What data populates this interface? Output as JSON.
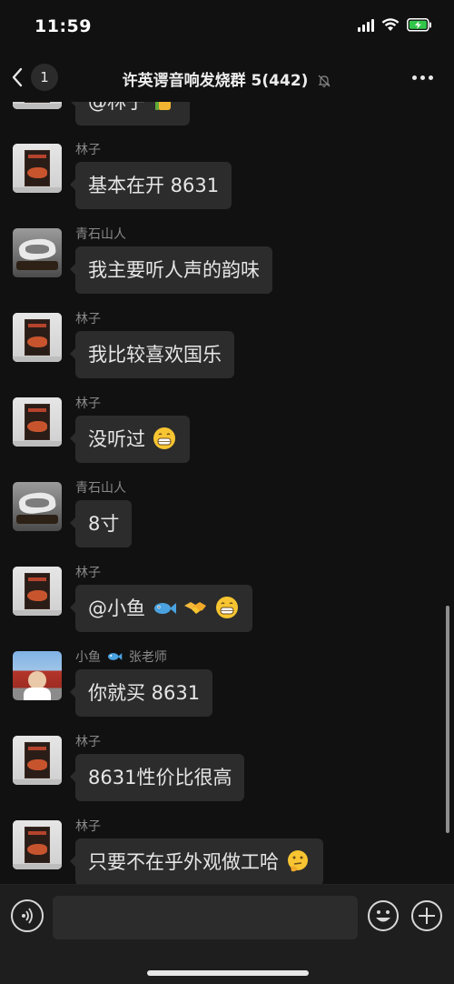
{
  "status_bar": {
    "time": "11:59"
  },
  "header": {
    "back_count": "1",
    "title": "许英谔音响发烧群 5(442)"
  },
  "messages": [
    {
      "sender": "",
      "text": "@林子",
      "avatar": "lin"
    },
    {
      "sender": "林子",
      "text": "基本在开 8631",
      "avatar": "lin"
    },
    {
      "sender": "青石山人",
      "text": "我主要听人声的韵味",
      "avatar": "qing"
    },
    {
      "sender": "林子",
      "text": "我比较喜欢国乐",
      "avatar": "lin"
    },
    {
      "sender": "林子",
      "text": "没听过",
      "avatar": "lin",
      "emoji": "grin"
    },
    {
      "sender": "青石山人",
      "text": "8寸",
      "avatar": "qing"
    },
    {
      "sender": "林子",
      "text": "@小鱼",
      "avatar": "lin",
      "emoji": "fish-handshake-grin"
    },
    {
      "sender": "小鱼",
      "sender_suffix": "张老师",
      "text": "你就买 8631",
      "avatar": "yu"
    },
    {
      "sender": "林子",
      "text": "8631性价比很高",
      "avatar": "lin"
    },
    {
      "sender": "林子",
      "text": "只要不在乎外观做工哈",
      "avatar": "lin",
      "emoji": "thinking"
    }
  ],
  "input": {
    "value": "",
    "placeholder": ""
  },
  "colors": {
    "background": "#111111",
    "bubble": "#2c2c2c",
    "sender": "#8a8a8a"
  },
  "icons": [
    "back-arrow-icon",
    "mute-bell-icon",
    "more-icon",
    "voice-icon",
    "emoji-icon",
    "plus-icon"
  ]
}
